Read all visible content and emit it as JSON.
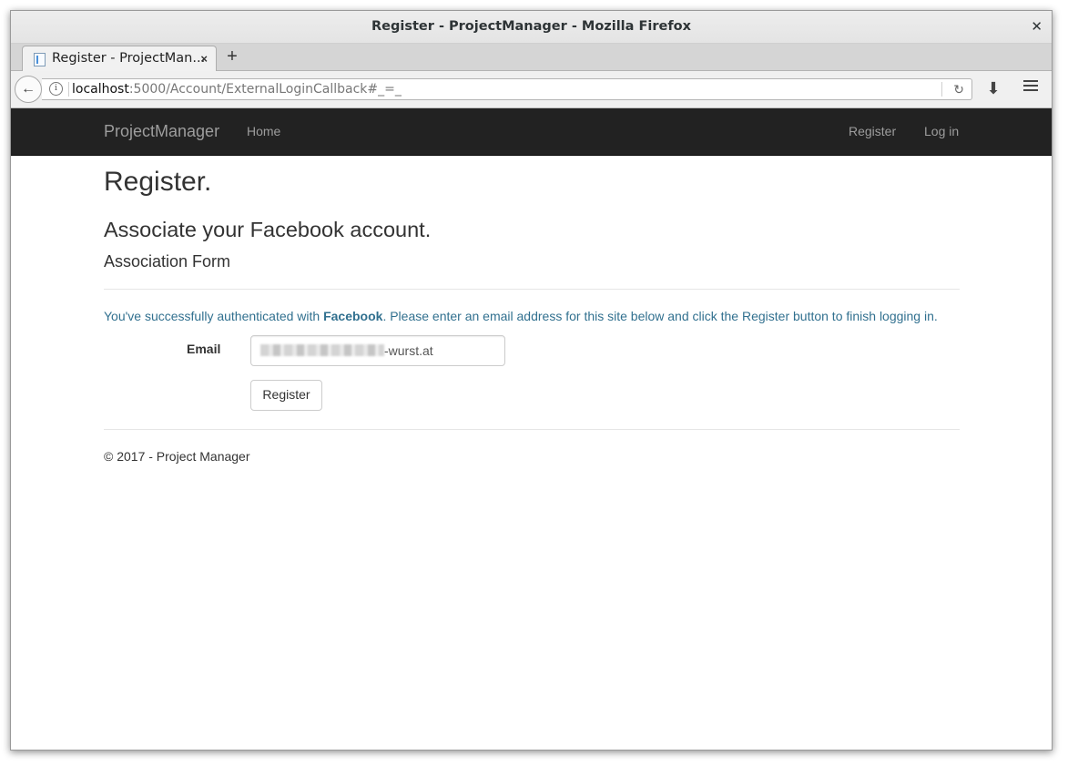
{
  "browser": {
    "window_title": "Register - ProjectManager - Mozilla Firefox",
    "tab_title": "Register - ProjectMan...",
    "tab_close": "×",
    "new_tab": "+",
    "url_host": "localhost",
    "url_rest": ":5000/Account/ExternalLoginCallback#_=_",
    "icons": {
      "close": "close-icon",
      "back": "arrow-left-icon",
      "info": "info-icon",
      "reload": "reload-icon",
      "download": "download-icon",
      "menu": "hamburger-menu-icon",
      "favicon": "page-icon"
    }
  },
  "site_nav": {
    "brand": "ProjectManager",
    "home": "Home",
    "register": "Register",
    "login": "Log in"
  },
  "main": {
    "title": "Register.",
    "subtitle": "Associate your Facebook account.",
    "form_title": "Association Form",
    "info_prefix": "You've successfully authenticated with ",
    "info_provider": "Facebook",
    "info_suffix": ". Please enter an email address for this site below and click the Register button to finish logging in.",
    "email_label": "Email",
    "email_value_visible": "-wurst.at",
    "register_button": "Register"
  },
  "footer": {
    "text": "© 2017 - Project Manager"
  },
  "colors": {
    "navbar_bg": "#222222",
    "nav_link": "#9d9d9d",
    "info_text": "#31708f",
    "body_text": "#333333"
  }
}
